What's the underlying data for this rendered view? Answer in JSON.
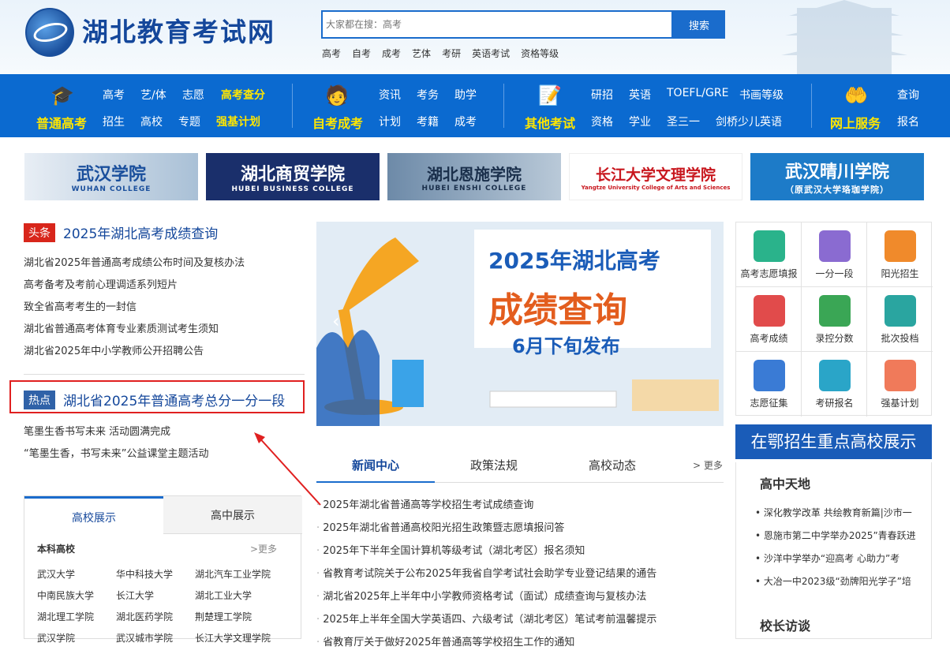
{
  "header": {
    "site_title": "湖北教育考试网",
    "search_placeholder": "大家都在搜：高考",
    "search_button": "搜索",
    "hot_links": [
      "高考",
      "自考",
      "成考",
      "艺体",
      "考研",
      "英语考试",
      "资格等级"
    ]
  },
  "nav": {
    "groups": [
      {
        "main": "普通高考",
        "icon": "graduation-cap-icon",
        "links_row1": [
          "高考",
          "艺/体",
          "志愿",
          "高考查分"
        ],
        "links_row2": [
          "招生",
          "高校",
          "专题",
          "强基计划"
        ]
      },
      {
        "main": "自考成考",
        "icon": "student-icon",
        "links_row1": [
          "资讯",
          "考务",
          "助学"
        ],
        "links_row2": [
          "计划",
          "考籍",
          "成考"
        ]
      },
      {
        "main": "其他考试",
        "icon": "document-edit-icon",
        "links_row1": [
          "研招",
          "英语",
          "TOEFL/GRE",
          "书画等级"
        ],
        "links_row2": [
          "资格",
          "学业",
          "圣三一",
          "剑桥少儿英语"
        ]
      },
      {
        "main": "网上服务",
        "icon": "hand-service-icon",
        "links_row1": [
          "查询"
        ],
        "links_row2": [
          "报名"
        ]
      }
    ]
  },
  "banners": [
    {
      "name": "武汉学院",
      "sub": "WUHAN COLLEGE",
      "color": "#2a6a9a"
    },
    {
      "name": "湖北商贸学院",
      "sub": "HUBEI BUSINESS COLLEGE",
      "color": "#1a2f6b"
    },
    {
      "name": "湖北恩施学院",
      "sub": "HUBEI ENSHI COLLEGE",
      "color": "#4e6e8e"
    },
    {
      "name": "长江大学文理学院",
      "sub": "Yangtze University College of Arts and Sciences",
      "color": "#ffffff"
    },
    {
      "name": "武汉晴川学院",
      "sub": "（原武汉大学珞珈学院）",
      "color": "#1d7bc8"
    }
  ],
  "headline": {
    "tag": "头条",
    "title": "2025年湖北高考成绩查询",
    "items": [
      "湖北省2025年普通高考成绩公布时间及复核办法",
      "高考备考及考前心理调适系列短片",
      "致全省高考考生的一封信",
      "湖北省普通高考体育专业素质测试考生须知",
      "湖北省2025年中小学教师公开招聘公告"
    ]
  },
  "hot": {
    "tag": "热点",
    "title": "湖北省2025年普通高考总分一分一段",
    "items": [
      "笔墨生香书写未来 活动圆满完成",
      "“笔墨生香，书写未来”公益课堂主题活动"
    ]
  },
  "school_tabs": {
    "tabs": [
      "高校展示",
      "高中展示"
    ],
    "section": "本科高校",
    "more": ">更多",
    "schools": [
      [
        "武汉大学",
        "华中科技大学",
        "湖北汽车工业学院"
      ],
      [
        "中南民族大学",
        "长江大学",
        "湖北工业大学"
      ],
      [
        "湖北理工学院",
        "湖北医药学院",
        "荆楚理工学院"
      ],
      [
        "武汉学院",
        "武汉城市学院",
        "长江大学文理学院"
      ]
    ]
  },
  "carousel": {
    "line1": "2025年湖北高考",
    "line2": "成绩查询",
    "line3": "6月下旬发布"
  },
  "news_tabs": {
    "tabs": [
      "新闻中心",
      "政策法规",
      "高校动态"
    ],
    "more": "> 更多",
    "items": [
      "2025年湖北省普通高等学校招生考试成绩查询",
      "2025年湖北省普通高校阳光招生政策暨志愿填报问答",
      "2025年下半年全国计算机等级考试（湖北考区）报名须知",
      "省教育考试院关于公布2025年我省自学考试社会助学专业登记结果的通告",
      "湖北省2025年上半年中小学教师资格考试（面试）成绩查询与复核办法",
      "2025年上半年全国大学英语四、六级考试（湖北考区）笔试考前温馨提示",
      "省教育厅关于做好2025年普通高等学校招生工作的通知"
    ]
  },
  "services": [
    {
      "label": "高考志愿填报",
      "icon": "volunteer-icon",
      "color": "#2ab38b"
    },
    {
      "label": "一分一段",
      "icon": "score-icon",
      "color": "#8a6bd1"
    },
    {
      "label": "阳光招生",
      "icon": "book-icon",
      "color": "#f08a2b"
    },
    {
      "label": "高考成绩",
      "icon": "cap-search-icon",
      "color": "#e14b4b"
    },
    {
      "label": "录控分数",
      "icon": "report-icon",
      "color": "#3aa655"
    },
    {
      "label": "批次投档",
      "icon": "calendar-icon",
      "color": "#2aa5a0"
    },
    {
      "label": "志愿征集",
      "icon": "doc-search-icon",
      "color": "#3a7bd5"
    },
    {
      "label": "考研报名",
      "icon": "books-icon",
      "color": "#2aa5c8"
    },
    {
      "label": "强基计划",
      "icon": "building-icon",
      "color": "#f07a5a"
    }
  ],
  "right_panel": {
    "blue_title": "在鄂招生重点高校展示",
    "section1": "高中天地",
    "items": [
      "深化教学改革 共绘教育新篇|沙市一",
      "恩施市第二中学举办2025”青春跃进",
      "沙洋中学举办“迎高考 心助力”考",
      "大冶一中2023级“劲牌阳光学子”培"
    ],
    "section2": "校长访谈"
  }
}
